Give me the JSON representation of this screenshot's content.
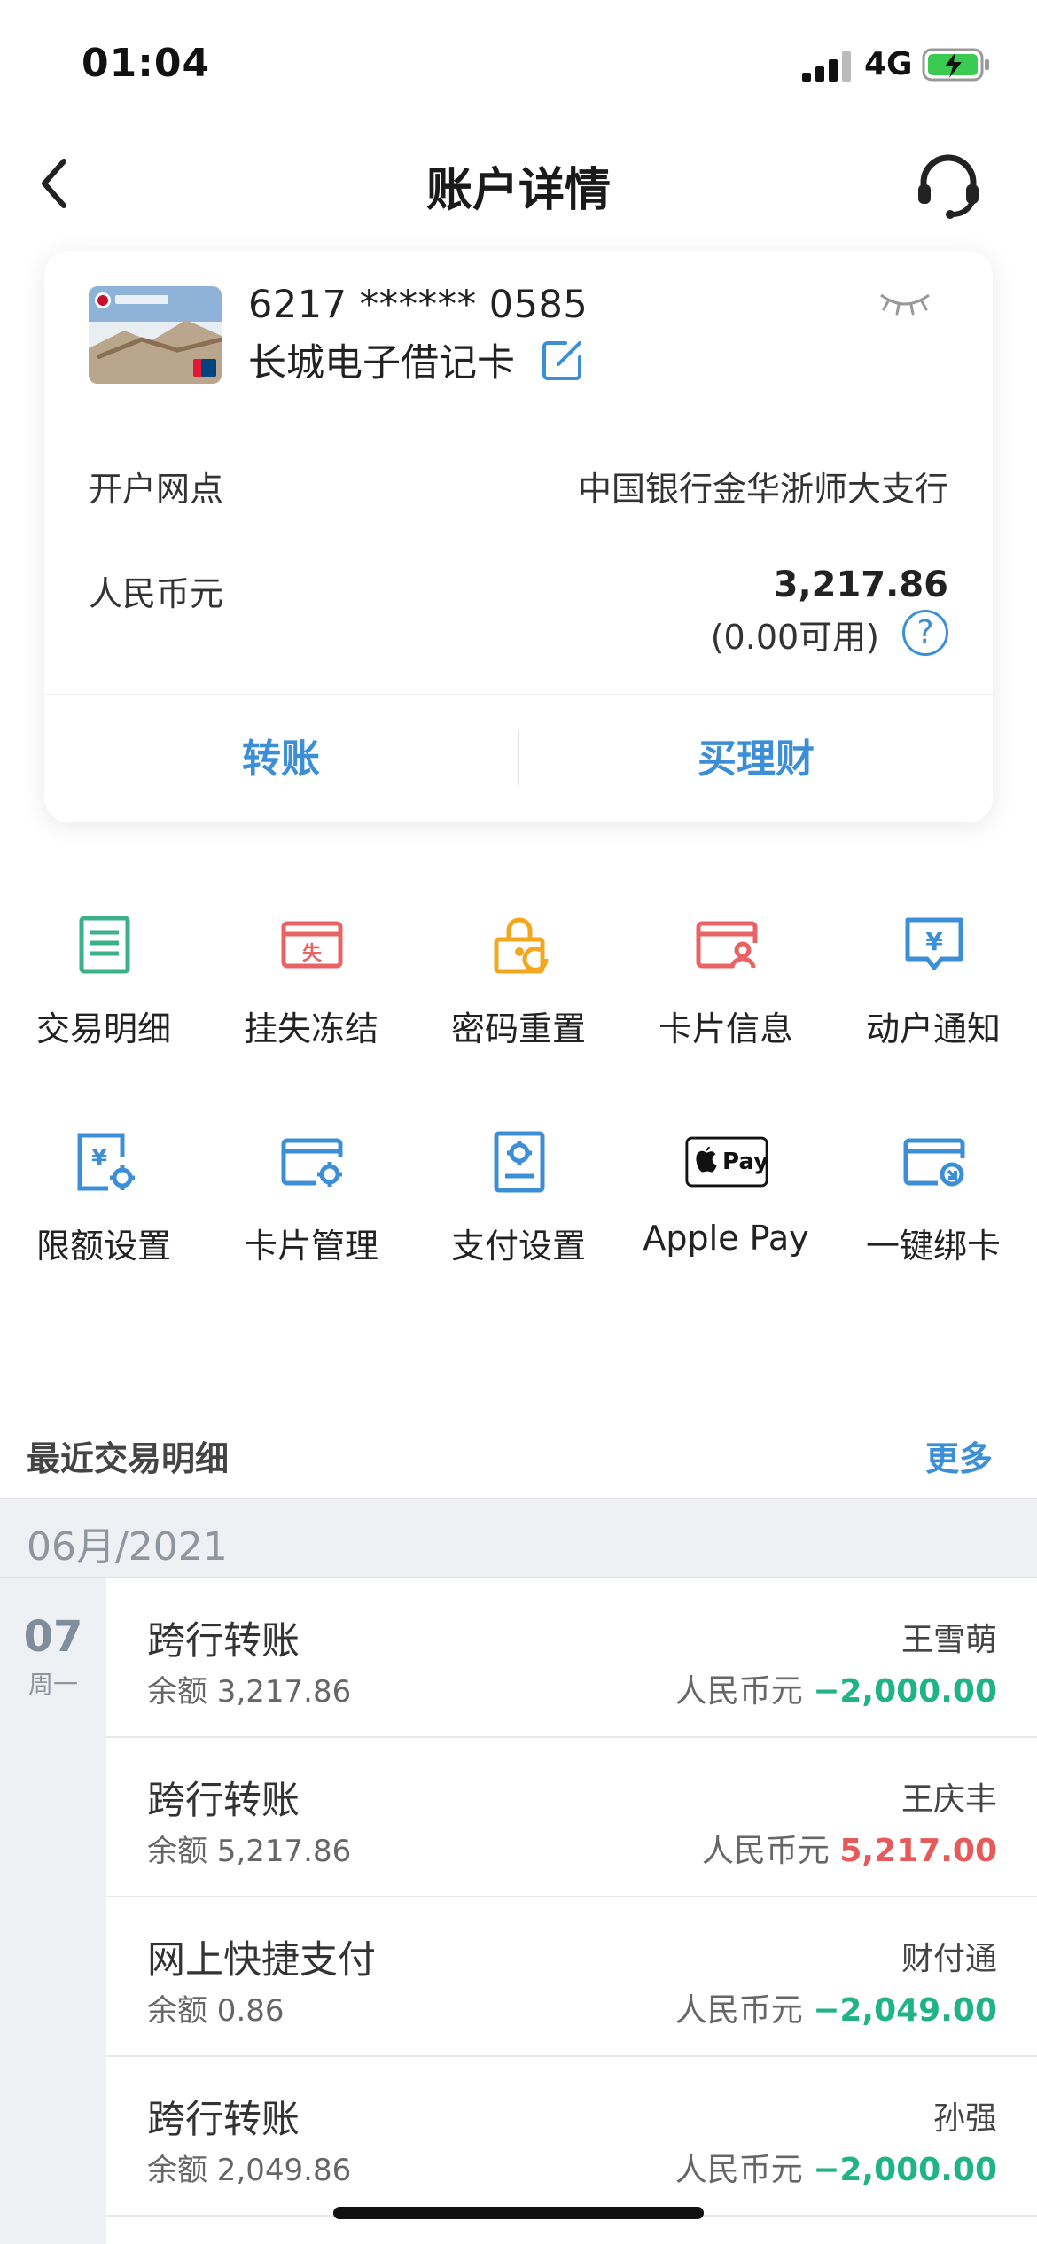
{
  "status_bar": {
    "time": "01:04",
    "network": "4G"
  },
  "nav": {
    "title": "账户详情"
  },
  "card": {
    "number": "6217 ****** 0585",
    "name": "长城电子借记卡",
    "branch_label": "开户网点",
    "branch_value": "中国银行金华浙师大支行",
    "currency_label": "人民币元",
    "balance": "3,217.86",
    "available": "(0.00可用)",
    "help_symbol": "?",
    "actions": {
      "transfer": "转账",
      "buy_wealth": "买理财"
    }
  },
  "functions": [
    {
      "label": "交易明细",
      "icon": "transaction-list-icon",
      "color": "#3cb08a"
    },
    {
      "label": "挂失冻结",
      "icon": "report-loss-icon",
      "color": "#e86464"
    },
    {
      "label": "密码重置",
      "icon": "password-reset-icon",
      "color": "#f2a71c"
    },
    {
      "label": "卡片信息",
      "icon": "card-info-icon",
      "color": "#e86464"
    },
    {
      "label": "动户通知",
      "icon": "account-notice-icon",
      "color": "#3c8fd6"
    },
    {
      "label": "限额设置",
      "icon": "limit-settings-icon",
      "color": "#3c8fd6"
    },
    {
      "label": "卡片管理",
      "icon": "card-management-icon",
      "color": "#3c8fd6"
    },
    {
      "label": "支付设置",
      "icon": "payment-settings-icon",
      "color": "#3c8fd6"
    },
    {
      "label": "Apple Pay",
      "icon": "apple-pay-icon",
      "icon_text": "Pay",
      "color": "#111111"
    },
    {
      "label": "一键绑卡",
      "icon": "one-click-bind-icon",
      "color": "#3c8fd6"
    }
  ],
  "recent": {
    "title": "最近交易明细",
    "more": "更多",
    "month": "06月/2021",
    "date_day": "07",
    "date_week": "周一",
    "transactions": [
      {
        "type": "跨行转账",
        "balance": "余额 3,217.86",
        "party": "王雪萌",
        "currency": "人民币元",
        "amount": "−2,000.00"
      },
      {
        "type": "跨行转账",
        "balance": "余额 5,217.86",
        "party": "王庆丰",
        "currency": "人民币元",
        "amount": "5,217.00"
      },
      {
        "type": "网上快捷支付",
        "balance": "余额 0.86",
        "party": "财付通",
        "currency": "人民币元",
        "amount": "−2,049.00"
      },
      {
        "type": "跨行转账",
        "balance": "余额 2,049.86",
        "party": "孙强",
        "currency": "人民币元",
        "amount": "−2,000.00"
      }
    ]
  },
  "colors": {
    "accent": "#3c8fd6",
    "debit": "#1fb385",
    "credit": "#e75a5a"
  }
}
